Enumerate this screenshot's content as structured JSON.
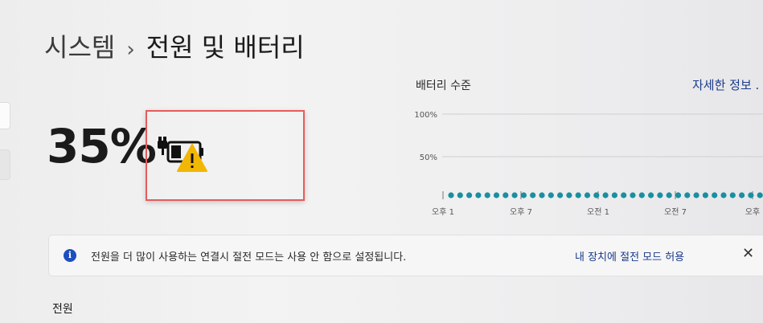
{
  "breadcrumb": {
    "parent": "시스템",
    "separator": "›",
    "current": "전원 및 배터리"
  },
  "battery": {
    "percent_label": "35%",
    "status_icon": "battery-plugged-warning-icon",
    "warning_color": "#f2b705"
  },
  "chart_panel": {
    "title": "배터리 수준",
    "more_info_link": "자세한 정보 ."
  },
  "chart_data": {
    "type": "scatter",
    "title": "배터리 수준",
    "y_ticks": [
      "100%",
      "50%"
    ],
    "ylim": [
      0,
      100
    ],
    "x_tick_labels": [
      "오후 1",
      "오후 7",
      "오전 1",
      "오전 7",
      "오후"
    ],
    "dot_count": 36,
    "dot_color": "#1a8fa0",
    "grid": true
  },
  "info_bar": {
    "icon": "info-icon",
    "message": "전원을 더 많이 사용하는 연결시 절전 모드는 사용 안 함으로 설정됩니다.",
    "action_label": "내 장치에 절전 모드 허용",
    "close_label": "✕",
    "accent_color": "#1f4fbf"
  },
  "section": {
    "heading": "전원"
  }
}
